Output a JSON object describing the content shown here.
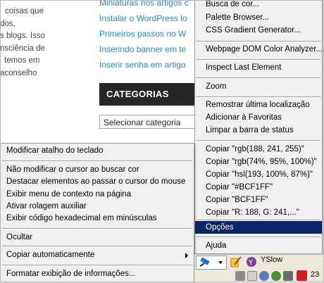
{
  "page": {
    "side_text": [
      "coisas que",
      "dos,",
      "s blogs. Isso",
      "nsciência de",
      "temos em",
      "aconselho"
    ],
    "links": [
      "Miniaturas nos artigos c",
      "Instalar o WordPress lo",
      "Primeiros passos no W",
      "Inserindo banner em te",
      "Inserir senha em artigo"
    ],
    "categories_title": "CATEGORIAS",
    "category_select": "Selecionar categoria"
  },
  "right_menu": {
    "items": [
      "Busca de cor...",
      "Palette Browser...",
      "CSS Gradient Generator...",
      "Webpage DOM Color Analyzer...",
      "Inspect Last Element",
      "Zoom",
      "Remostrar última localização",
      "Adicionar à Favoritas",
      "Limpar a barra de status",
      "Copiar \"rgb(188, 241, 255)\"",
      "Copiar \"rgb(74%, 95%, 100%)\"",
      "Copiar \"hsl(193, 100%, 87%)\"",
      "Copiar \"#BCF1FF\"",
      "Copiar \"BCF1FF\"",
      "Copiar \"R: 188, G: 241,...\"",
      "Opções",
      "Ajuda"
    ]
  },
  "left_menu": {
    "items": [
      "Modificar atalho do teclado",
      "Não modificar o cursor ao buscar cor",
      "Destacar elementos ao passar o cursor do mouse",
      "Exibir menu de contexto na página",
      "Ativar rolagem auxiliar",
      "Exibir código hexadecimal em minúsculas",
      "Ocultar",
      "Copiar automaticamente",
      "Formatar exibição de informações..."
    ]
  },
  "statusbar": {
    "yslow_label": "YSlow",
    "count": "23"
  },
  "colors": {
    "highlight": "#0a246a",
    "link": "#2b87c4",
    "menu_bg": "#f0f0f0"
  },
  "icons": [
    "eyedropper-icon",
    "edit-icon",
    "yslow-icon",
    "addon-icon",
    "pause-icon",
    "settings-icon",
    "refresh-icon",
    "no-icon"
  ]
}
